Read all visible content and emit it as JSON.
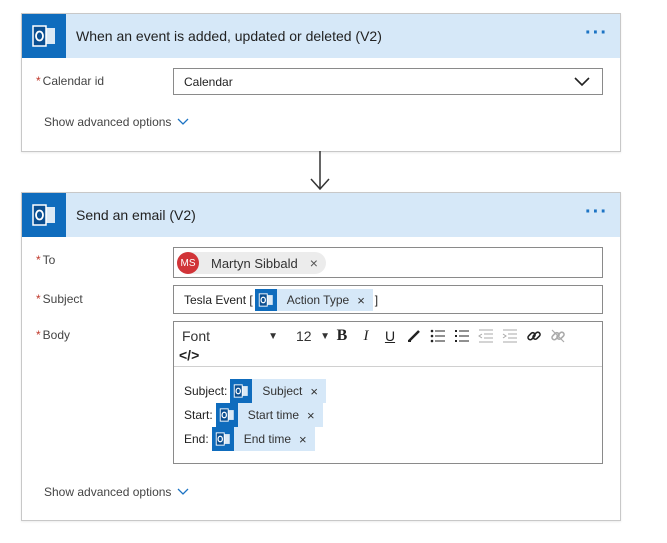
{
  "trigger": {
    "title": "When an event is added, updated or deleted (V2)",
    "calendar_label": "Calendar id",
    "calendar_value": "Calendar",
    "advanced": "Show advanced options"
  },
  "action": {
    "title": "Send an email (V2)",
    "to_label": "To",
    "to_initials": "MS",
    "to_name": "Martyn Sibbald",
    "subject_label": "Subject",
    "subject_prefix": "Tesla Event [",
    "subject_token": "Action Type",
    "subject_suffix": "]",
    "body_label": "Body",
    "font": "Font",
    "size": "12",
    "body_lines": [
      {
        "label": "Subject:",
        "token": "Subject"
      },
      {
        "label": "Start:",
        "token": "Start time"
      },
      {
        "label": "End:",
        "token": "End time"
      }
    ],
    "advanced": "Show advanced options"
  },
  "colors": {
    "accent": "#0f6cbd",
    "header_bg": "#d6e8f8",
    "avatar": "#d13438",
    "required": "#c0392b"
  },
  "icons": [
    "outlook-icon",
    "more-dots-icon",
    "chevron-down-icon",
    "remove-icon",
    "arrow-down-icon"
  ]
}
